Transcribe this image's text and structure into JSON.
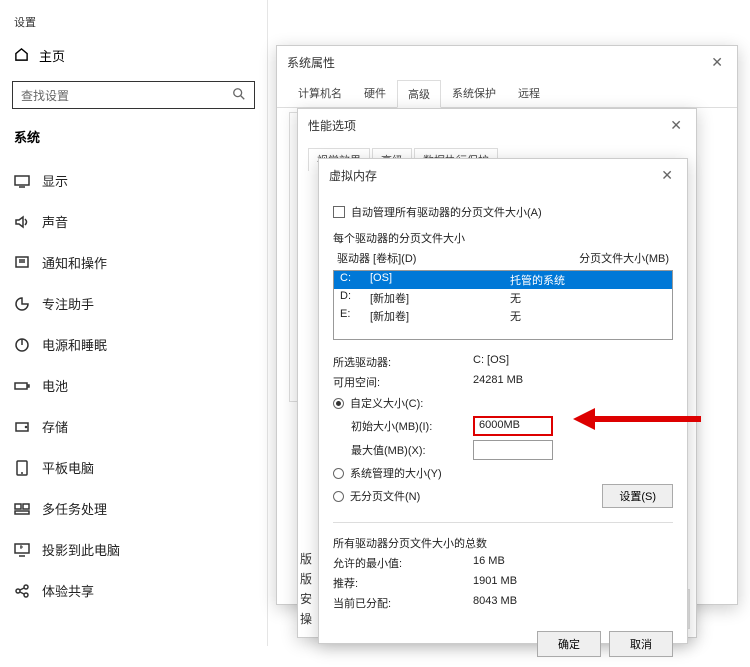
{
  "settings": {
    "title": "设置",
    "home": "主页",
    "searchPlaceholder": "查找设置",
    "category": "系统",
    "items": [
      {
        "label": "显示"
      },
      {
        "label": "声音"
      },
      {
        "label": "通知和操作"
      },
      {
        "label": "专注助手"
      },
      {
        "label": "电源和睡眠"
      },
      {
        "label": "电池"
      },
      {
        "label": "存储"
      },
      {
        "label": "平板电脑"
      },
      {
        "label": "多任务处理"
      },
      {
        "label": "投影到此电脑"
      },
      {
        "label": "体验共享"
      }
    ]
  },
  "sysprops": {
    "title": "系统属性",
    "tabs": [
      "计算机名",
      "硬件",
      "高级",
      "系统保护",
      "远程"
    ],
    "activeTab": 2
  },
  "perfopt": {
    "title": "性能选项",
    "tabs": [
      "视觉效果",
      "高级",
      "数据执行保护"
    ]
  },
  "virtmem": {
    "title": "虚拟内存",
    "autoManage": "自动管理所有驱动器的分页文件大小(A)",
    "perDriveLabel": "每个驱动器的分页文件大小",
    "driveCol": "驱动器 [卷标](D)",
    "pagefileCol": "分页文件大小(MB)",
    "drives": [
      {
        "letter": "C:",
        "label": "[OS]",
        "size": "托管的系统",
        "selected": true
      },
      {
        "letter": "D:",
        "label": "[新加卷]",
        "size": "无",
        "selected": false
      },
      {
        "letter": "E:",
        "label": "[新加卷]",
        "size": "无",
        "selected": false
      }
    ],
    "selectedDriveLabel": "所选驱动器:",
    "selectedDriveValue": "C:  [OS]",
    "freeSpaceLabel": "可用空间:",
    "freeSpaceValue": "24281 MB",
    "customSize": "自定义大小(C):",
    "initialSizeLabel": "初始大小(MB)(I):",
    "initialSizeValue": "6000MB",
    "maxSizeLabel": "最大值(MB)(X):",
    "maxSizeValue": "",
    "systemManaged": "系统管理的大小(Y)",
    "noPagefile": "无分页文件(N)",
    "setBtn": "设置(S)",
    "totalsTitle": "所有驱动器分页文件大小的总数",
    "minAllowedLabel": "允许的最小值:",
    "minAllowedValue": "16 MB",
    "recommendedLabel": "推荐:",
    "recommendedValue": "1901 MB",
    "currentLabel": "当前已分配:",
    "currentValue": "8043 MB",
    "ok": "确定",
    "cancel": "取消"
  },
  "edgeText": {
    "l1": "版",
    "l2": "版",
    "l3": "安",
    "l4": "操"
  }
}
